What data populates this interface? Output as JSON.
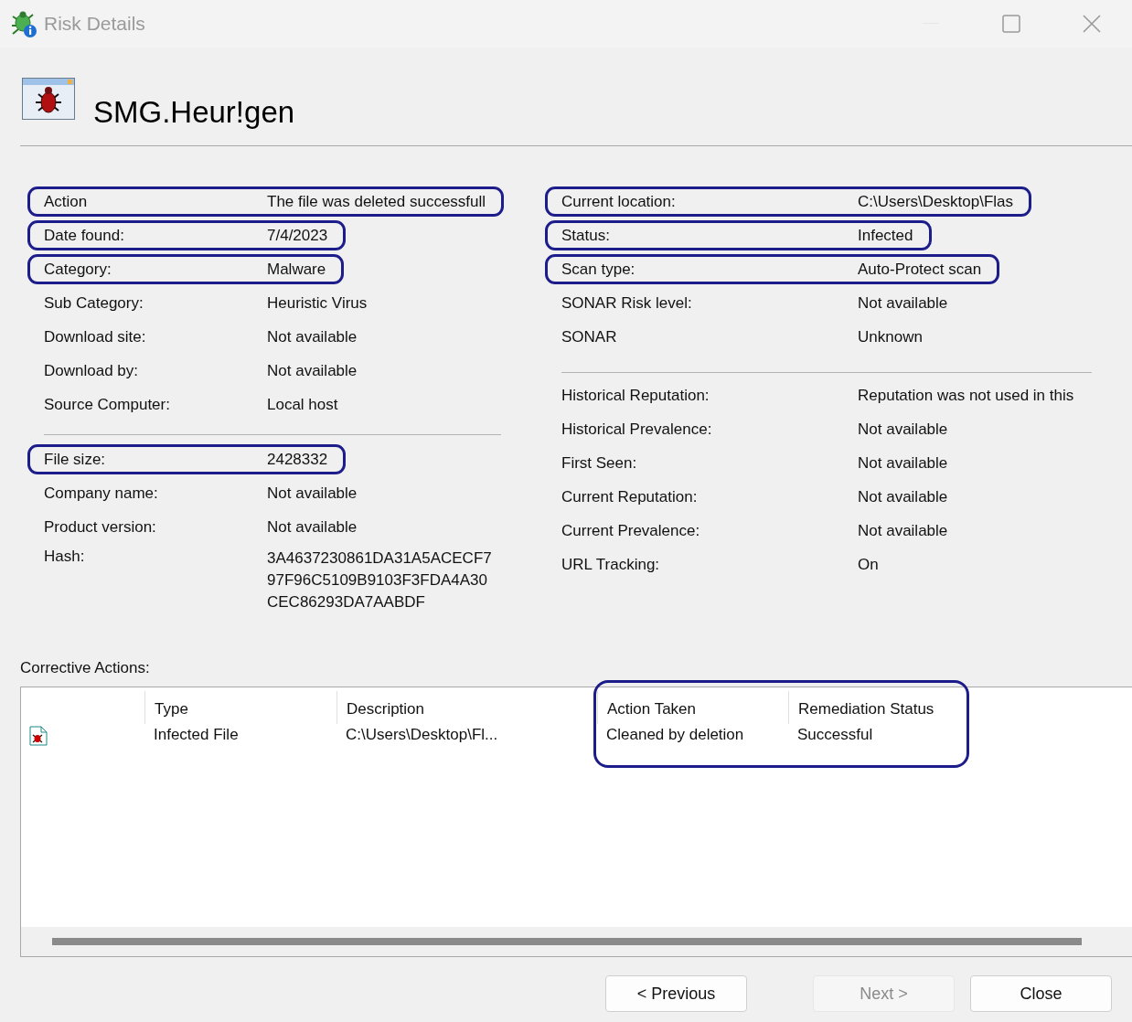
{
  "window": {
    "title": "Risk Details"
  },
  "threat": {
    "name": "SMG.Heur!gen"
  },
  "left_groups": [
    [
      {
        "label": "Action",
        "value": "The file was deleted successfull",
        "highlighted": true
      },
      {
        "label": "Date found:",
        "value": "7/4/2023",
        "highlighted": true
      },
      {
        "label": "Category:",
        "value": "Malware",
        "highlighted": true
      },
      {
        "label": "Sub Category:",
        "value": "Heuristic Virus",
        "highlighted": false
      },
      {
        "label": "Download site:",
        "value": "Not available",
        "highlighted": false
      },
      {
        "label": "Download by:",
        "value": "Not available",
        "highlighted": false
      },
      {
        "label": "Source Computer:",
        "value": "Local host",
        "highlighted": false
      }
    ],
    [
      {
        "label": "File size:",
        "value": "2428332",
        "highlighted": true
      },
      {
        "label": "Company name:",
        "value": "Not available",
        "highlighted": false
      },
      {
        "label": "Product version:",
        "value": "Not available",
        "highlighted": false
      },
      {
        "label": "Hash:",
        "value_lines": [
          "3A4637230861DA31A5ACECF7",
          "97F96C5109B9103F3FDA4A30",
          "CEC86293DA7AABDF"
        ],
        "highlighted": false
      }
    ]
  ],
  "right_groups": [
    [
      {
        "label": "Current location:",
        "value": "C:\\Users\\Desktop\\Flas",
        "highlighted": true
      },
      {
        "label": "Status:",
        "value": "Infected",
        "highlighted": true
      },
      {
        "label": "Scan type:",
        "value": "Auto-Protect scan",
        "highlighted": true
      },
      {
        "label": "SONAR Risk level:",
        "value": "Not available",
        "highlighted": false
      },
      {
        "label": "SONAR",
        "value": "Unknown",
        "highlighted": false
      }
    ],
    [
      {
        "label": "Historical Reputation:",
        "value": "Reputation was not used in this",
        "highlighted": false
      },
      {
        "label": "Historical Prevalence:",
        "value": "Not available",
        "highlighted": false
      },
      {
        "label": "First Seen:",
        "value": "Not available",
        "highlighted": false
      },
      {
        "label": "Current Reputation:",
        "value": "Not available",
        "highlighted": false
      },
      {
        "label": "Current Prevalence:",
        "value": "Not available",
        "highlighted": false
      },
      {
        "label": "URL Tracking:",
        "value": "On",
        "highlighted": false
      }
    ]
  ],
  "corrective_actions": {
    "label": "Corrective Actions:",
    "columns": [
      {
        "title": "Type",
        "highlighted": false
      },
      {
        "title": "Description",
        "highlighted": false
      },
      {
        "title": "Action Taken",
        "highlighted": true
      },
      {
        "title": "Remediation Status",
        "highlighted": true
      }
    ],
    "rows": [
      {
        "kind": "infected-file",
        "cells": [
          "Infected File",
          "C:\\Users\\Desktop\\Fl...",
          "Cleaned by deletion",
          "Successful"
        ]
      }
    ]
  },
  "buttons": [
    {
      "label": "< Previous",
      "disabled": false
    },
    {
      "label": "Next >",
      "disabled": true
    },
    {
      "label": "Close",
      "disabled": false
    }
  ]
}
